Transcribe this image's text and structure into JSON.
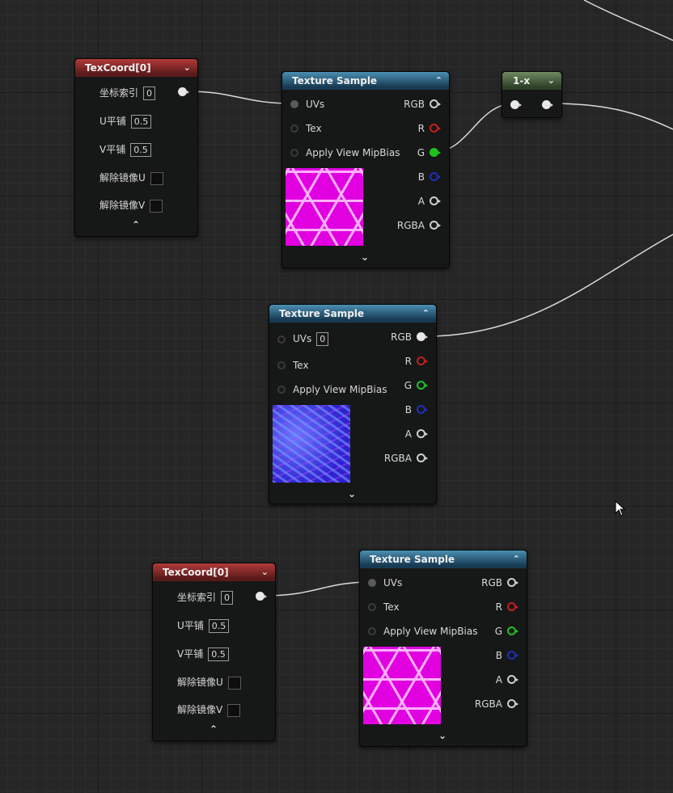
{
  "nodes": {
    "texcoord1": {
      "title": "TexCoord[0]",
      "coord_index_label": "坐标索引",
      "coord_index_value": "0",
      "u_tile_label": "U平铺",
      "u_tile_value": "0.5",
      "v_tile_label": "V平铺",
      "v_tile_value": "0.5",
      "unmirror_u_label": "解除镜像U",
      "unmirror_v_label": "解除镜像V"
    },
    "texsample1": {
      "title": "Texture Sample",
      "inputs": [
        "UVs",
        "Tex",
        "Apply View MipBias"
      ],
      "outputs": [
        "RGB",
        "R",
        "G",
        "B",
        "A",
        "RGBA"
      ],
      "thumbnail": "hexagon-pattern-magenta"
    },
    "oneminus": {
      "title": "1-x"
    },
    "texsample2": {
      "title": "Texture Sample",
      "uvs_value": "0",
      "inputs": [
        "UVs",
        "Tex",
        "Apply View MipBias"
      ],
      "outputs": [
        "RGB",
        "R",
        "G",
        "B",
        "A",
        "RGBA"
      ],
      "thumbnail": "normal-map-blue"
    },
    "texcoord2": {
      "title": "TexCoord[0]",
      "coord_index_label": "坐标索引",
      "coord_index_value": "0",
      "u_tile_label": "U平铺",
      "u_tile_value": "0.5",
      "v_tile_label": "V平铺",
      "v_tile_value": "0.5",
      "unmirror_u_label": "解除镜像U",
      "unmirror_v_label": "解除镜像V"
    },
    "texsample3": {
      "title": "Texture Sample",
      "inputs": [
        "UVs",
        "Tex",
        "Apply View MipBias"
      ],
      "outputs": [
        "RGB",
        "R",
        "G",
        "B",
        "A",
        "RGBA"
      ],
      "thumbnail": "hexagon-pattern-magenta"
    }
  },
  "icons": {
    "collapse": "chevron-up-icon",
    "expand": "chevron-down-icon",
    "header_menu": "chevron-down-icon",
    "cursor": "mouse-pointer-icon"
  },
  "colors": {
    "texcoord_header": "#8e2c2c",
    "texsample_header": "#2f6d8f",
    "oneminus_header": "#4f6845",
    "pin_red": "#c42020",
    "pin_green": "#1fc21f",
    "pin_blue": "#1f2fb8",
    "wire": "#d8d8d8",
    "background": "#262626"
  }
}
